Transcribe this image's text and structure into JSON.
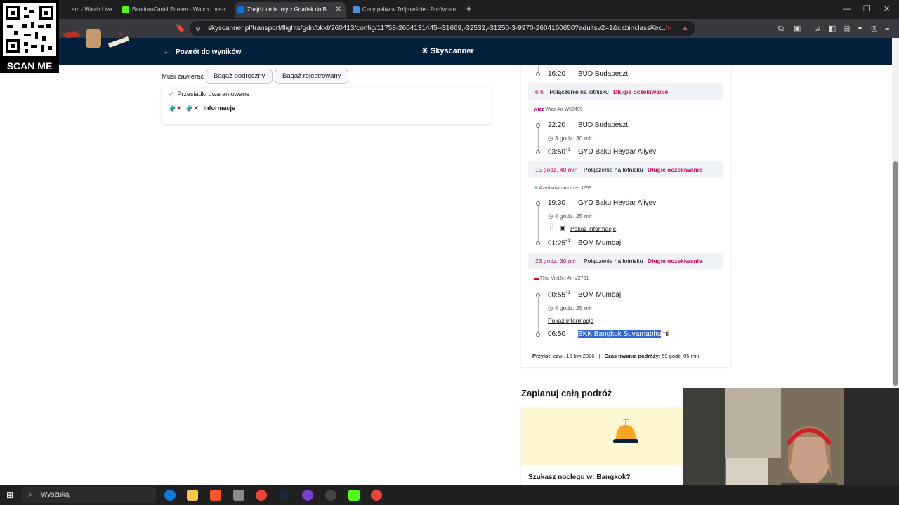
{
  "browser": {
    "tabs": [
      {
        "title": "am - Watch Live on K",
        "active": false
      },
      {
        "title": "BanduraCartel Stream - Watch Live o",
        "active": false
      },
      {
        "title": "Znajdź tanie loty z Gdańsk do B",
        "active": true
      },
      {
        "title": "Ceny paliw w Trójmieście - Porównan",
        "active": false
      }
    ],
    "url": "skyscanner.pl/transport/flights/gdn/bkkt/260413/config/11758-2604131445--31669,-32532,-31250-3-9970-2604160650?adultsv2=1&cabinclass=ec..."
  },
  "overlay": {
    "scan_label": "SCAN ME"
  },
  "header": {
    "back_label": "Powrót do wyników",
    "logo_text": "Skyscanner"
  },
  "filters": {
    "label": "Musi zawierać",
    "chips": [
      "Bagaż podręczny",
      "Bagaż rejestrowany"
    ]
  },
  "left_card": {
    "guaranteed": "Przesiadki gwarantowane",
    "info": "Informacje"
  },
  "itinerary": {
    "stop0": {
      "time": "16:20",
      "place": "BUD Budapeszt"
    },
    "conn1": {
      "duration": "6 h",
      "type": "Połączenie na lotnisku",
      "note": "Długie oczekiwanie"
    },
    "seg1": {
      "airline": "Wizz Air W62499",
      "dep_time": "22:20",
      "dep_place": "BUD Budapeszt",
      "duration": "3 godz. 30 min",
      "arr_time": "03:50",
      "arr_plus": "+1",
      "arr_place": "GYD Baku Heydar Aliyev"
    },
    "conn2": {
      "duration": "15 godz. 40 min",
      "type": "Połączenie na lotnisku",
      "note": "Długie oczekiwanie"
    },
    "seg2": {
      "airline": "Azerbaijan Airlines J259",
      "dep_time": "19:30",
      "dep_place": "GYD Baku Heydar Aliyev",
      "duration": "4 godz. 25 min",
      "info_link": "Pokaż informacje",
      "arr_time": "01:25",
      "arr_plus": "+1",
      "arr_place": "BOM Mumbaj"
    },
    "conn3": {
      "duration": "23 godz. 30 min",
      "type": "Połączenie na lotnisku",
      "note": "Długie oczekiwanie"
    },
    "seg3": {
      "airline": "Thai VietJet Air VZ761",
      "dep_time": "00:55",
      "dep_plus": "+1",
      "dep_place": "BOM Mumbaj",
      "duration": "4 godz. 25 min",
      "info_link": "Pokaż informacje",
      "arr_time": "06:50",
      "arr_place_sel": "BKK Bangkok Suvarnabhu",
      "arr_place_rest": "mi"
    },
    "summary": {
      "arrival_label": "Przylot:",
      "arrival_value": "czw., 16 kwi 2026",
      "sep": "|",
      "duration_label": "Czas trwania podróży:",
      "duration_value": "59 godz. 05 min"
    }
  },
  "plan": {
    "title": "Zaplanuj całą podróż",
    "card_text": "Szukasz noclegu w: Bangkok?"
  },
  "taskbar": {
    "search_placeholder": "Wyszukaj"
  },
  "colors": {
    "header_bg": "#05203c",
    "accent_pink": "#c60a57",
    "selection": "#3367d6"
  }
}
